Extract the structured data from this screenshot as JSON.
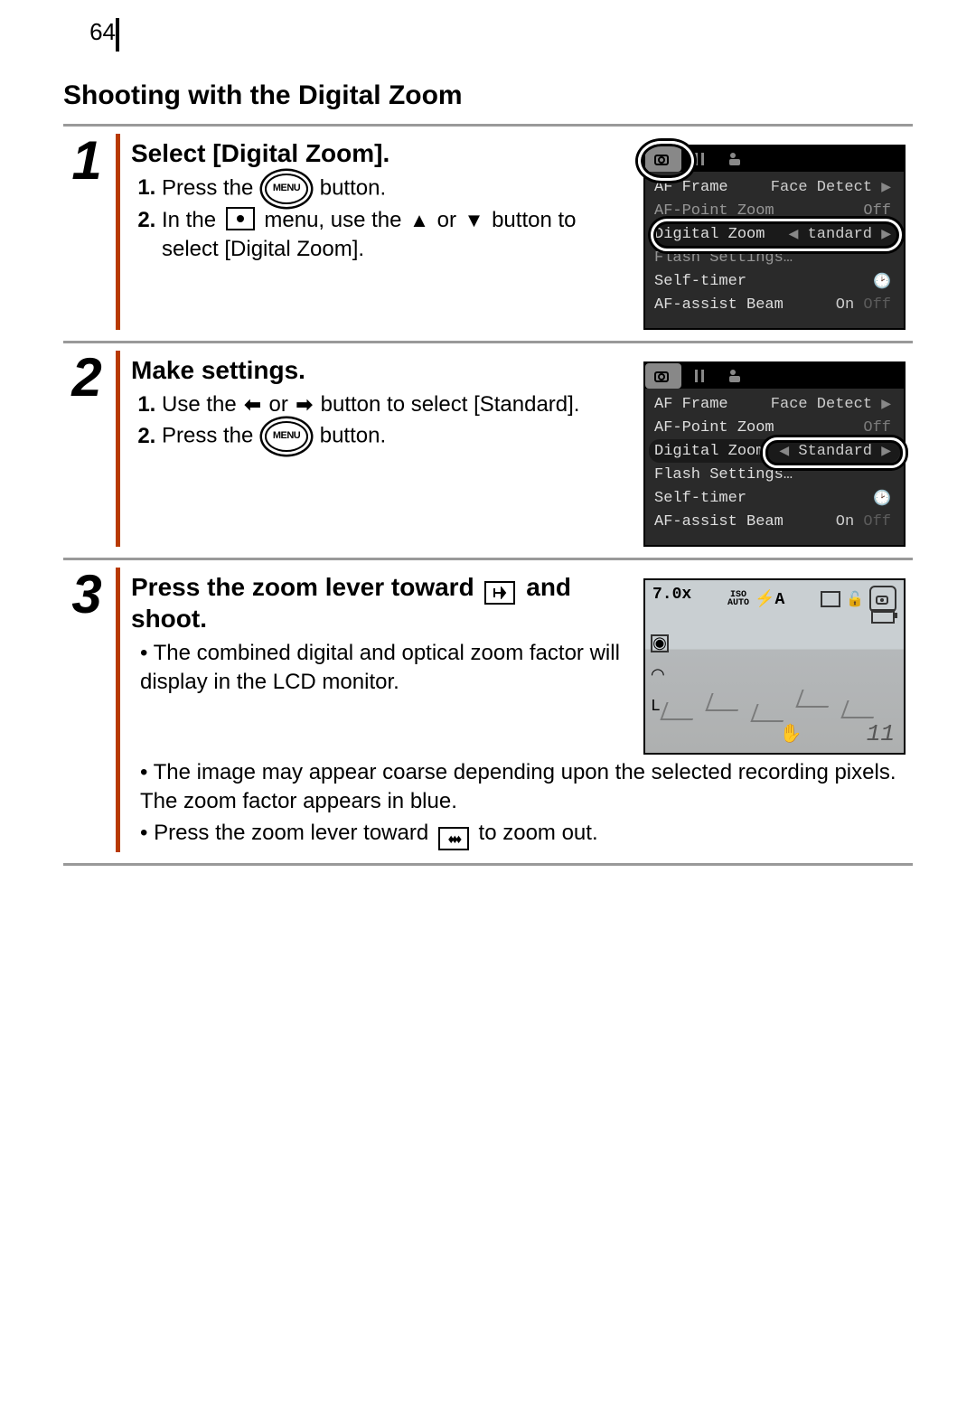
{
  "page_number": "64",
  "section_title": "Shooting with the Digital Zoom",
  "steps": {
    "s1": {
      "num": "1",
      "title": "Select [Digital Zoom].",
      "li1_a": "Press the ",
      "li1_b": " button.",
      "menu_label": "MENU",
      "li2_a": "In the ",
      "li2_b": " menu, use the ",
      "li2_c": " or ",
      "li2_d": " button to select [Digital Zoom]."
    },
    "s2": {
      "num": "2",
      "title": "Make settings.",
      "li1_a": "Use the ",
      "li1_b": " or ",
      "li1_c": " button to select [Standard].",
      "li2_a": "Press the ",
      "li2_b": " button.",
      "menu_label": "MENU"
    },
    "s3": {
      "num": "3",
      "title_a": "Press the zoom lever toward ",
      "title_b": " and shoot.",
      "b1": "The combined digital and optical zoom factor will display in the LCD monitor.",
      "b2": "The image may appear coarse depending upon the selected recording pixels. The zoom factor appears in blue.",
      "b3_a": "Press the zoom lever toward ",
      "b3_b": " to zoom out."
    }
  },
  "menu_screen": {
    "rows": {
      "af_frame": {
        "label": "AF Frame",
        "value": "Face Detect"
      },
      "af_point_zoom": {
        "label": "AF-Point Zoom",
        "value": "Off"
      },
      "digital_zoom": {
        "label": "Digital Zoom",
        "value": "Standard"
      },
      "digital_zoom_trunc": "tandard",
      "flash_settings": {
        "label": "Flash Settings…",
        "value": ""
      },
      "self_timer": {
        "label": "Self-timer",
        "value": ""
      },
      "af_assist": {
        "label": "AF-assist Beam",
        "value": "On"
      }
    }
  },
  "lcd": {
    "zoom_factor": "7.0x",
    "iso": "ISO\nAUTO",
    "shots": "11"
  }
}
